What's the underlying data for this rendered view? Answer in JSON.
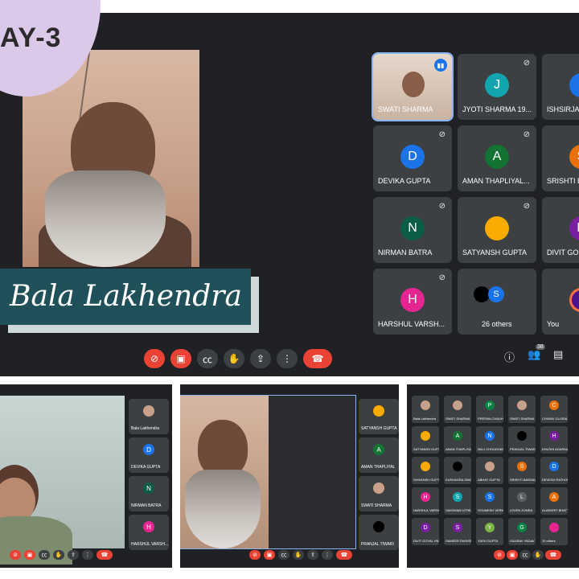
{
  "banner": {
    "day_text": "AY-3"
  },
  "speaker": {
    "name": "Bala Lakhendra"
  },
  "colors": {
    "meet_bg": "#202124",
    "tile_bg": "#3c4043",
    "end_call_red": "#ea4335",
    "accent_blue": "#1a73e8",
    "name_banner": "#20505a",
    "day_badge": "#dcc9ea"
  },
  "participants": [
    {
      "name": "SWATI SHARMA",
      "initial": "",
      "color": "",
      "camera_on": true,
      "speaking": true
    },
    {
      "name": "JYOTI SHARMA 19...",
      "initial": "J",
      "color": "#12a4af",
      "muted": true
    },
    {
      "name": "ISHSIRJA",
      "initial": "I",
      "color": "#1a73e8",
      "muted": true
    },
    {
      "name": "DEVIKA GUPTA",
      "initial": "D",
      "color": "#1a73e8",
      "muted": true
    },
    {
      "name": "AMAN THAPLIYAL...",
      "initial": "A",
      "color": "#137333",
      "muted": true
    },
    {
      "name": "SRISHTI B",
      "initial": "S",
      "color": "#e8710a",
      "muted": true
    },
    {
      "name": "NIRMAN BATRA",
      "initial": "N",
      "color": "#0b5d45",
      "muted": true
    },
    {
      "name": "SATYANSH GUPTA",
      "initial": "",
      "color": "#f9ab00",
      "muted": true
    },
    {
      "name": "DIVIT GO",
      "initial": "D",
      "color": "#7b1fa2",
      "muted": true
    },
    {
      "name": "HARSHUL VARSH...",
      "initial": "H",
      "color": "#e52592",
      "muted": true
    },
    {
      "name": "26 others",
      "initial": "S",
      "color": "#1a73e8",
      "muted": false
    },
    {
      "name": "You",
      "initial": "",
      "color": "#4a148c",
      "muted": false
    }
  ],
  "toolbar": {
    "mic_icon": "mic-off-icon",
    "cam_icon": "videocam-off-icon",
    "cc_icon": "closed-caption-icon",
    "hand_icon": "raise-hand-icon",
    "present_icon": "present-screen-icon",
    "more_icon": "more-vert-icon",
    "end_icon": "end-call-icon",
    "info_icon": "info-icon",
    "people_icon": "people-icon",
    "people_count": "38",
    "chat_icon": "chat-icon"
  },
  "strip1": {
    "side_tiles": [
      {
        "name": "Bala Lakhendra",
        "initial": "",
        "color": "#c9a18b"
      },
      {
        "name": "DEVIKA GUPTA",
        "initial": "D",
        "color": "#1a73e8"
      },
      {
        "name": "NIRMAN BATRA",
        "initial": "N",
        "color": "#0b5d45"
      },
      {
        "name": "HARSHUL VARSH...",
        "initial": "H",
        "color": "#e52592"
      }
    ]
  },
  "strip2": {
    "side_tiles": [
      {
        "name": "SATYANSH GUPTA",
        "initial": "",
        "color": "#f9ab00"
      },
      {
        "name": "AMAN THAPLIYAL",
        "initial": "A",
        "color": "#137333"
      },
      {
        "name": "SWATI SHARMA",
        "initial": "",
        "color": "#c9a18b"
      },
      {
        "name": "PRANJAL TIWARI",
        "initial": "",
        "color": "#000000"
      }
    ]
  },
  "strip3": {
    "grid": [
      {
        "name": "Bala Lakhendra",
        "initial": "",
        "color": "#c9a18b"
      },
      {
        "name": "SWATI SHARMA",
        "initial": "",
        "color": "#c9a18b"
      },
      {
        "name": "PRERNA CHAUH...",
        "initial": "P",
        "color": "#0b8043"
      },
      {
        "name": "SWATI SHARMA",
        "initial": "",
        "color": "#c9a18b"
      },
      {
        "name": "CHINNU GUJRAL",
        "initial": "C",
        "color": "#e8710a"
      },
      {
        "name": "SATYANSH GUPTA",
        "initial": "",
        "color": "#f9ab00"
      },
      {
        "name": "AMAN THAPLIYAL",
        "initial": "A",
        "color": "#137333"
      },
      {
        "name": "NILU CHOUDHARY",
        "initial": "N",
        "color": "#1a73e8"
      },
      {
        "name": "PRANJAL TIWARI",
        "initial": "",
        "color": "#000000"
      },
      {
        "name": "KHUSHI AGARWAL",
        "initial": "H",
        "color": "#7b1fa2"
      },
      {
        "name": "SHIVANSH GUPT...",
        "initial": "",
        "color": "#f9ab00"
      },
      {
        "name": "KUSHAGRA SING...",
        "initial": "",
        "color": "#000000"
      },
      {
        "name": "ABHAY GUPTA",
        "initial": "",
        "color": "#c9a18b"
      },
      {
        "name": "SRISHTI BANSAL",
        "initial": "S",
        "color": "#e8710a"
      },
      {
        "name": "DEVESH RATHORE",
        "initial": "D",
        "color": "#1a73e8"
      },
      {
        "name": "HARSHUL VARSH...",
        "initial": "H",
        "color": "#e52592"
      },
      {
        "name": "SAKSHAM UTREJA",
        "initial": "S",
        "color": "#12a4af"
      },
      {
        "name": "SOUMESH VERMA",
        "initial": "S",
        "color": "#1a73e8"
      },
      {
        "name": "LEVEN ZONRA",
        "initial": "L",
        "color": "#5f6368"
      },
      {
        "name": "ALANKRIT BHATT",
        "initial": "A",
        "color": "#e8710a"
      },
      {
        "name": "DIVIT GOYAL HN...",
        "initial": "D",
        "color": "#7b1fa2"
      },
      {
        "name": "SAMEER DWIVEDI",
        "initial": "S",
        "color": "#7b1fa2"
      },
      {
        "name": "YASH GUPTA",
        "initial": "Y",
        "color": "#7cb342"
      },
      {
        "name": "GAURAV YADAV H...",
        "initial": "G",
        "color": "#0b8043"
      },
      {
        "name": "10 others",
        "initial": "",
        "color": "#e52592"
      }
    ]
  }
}
